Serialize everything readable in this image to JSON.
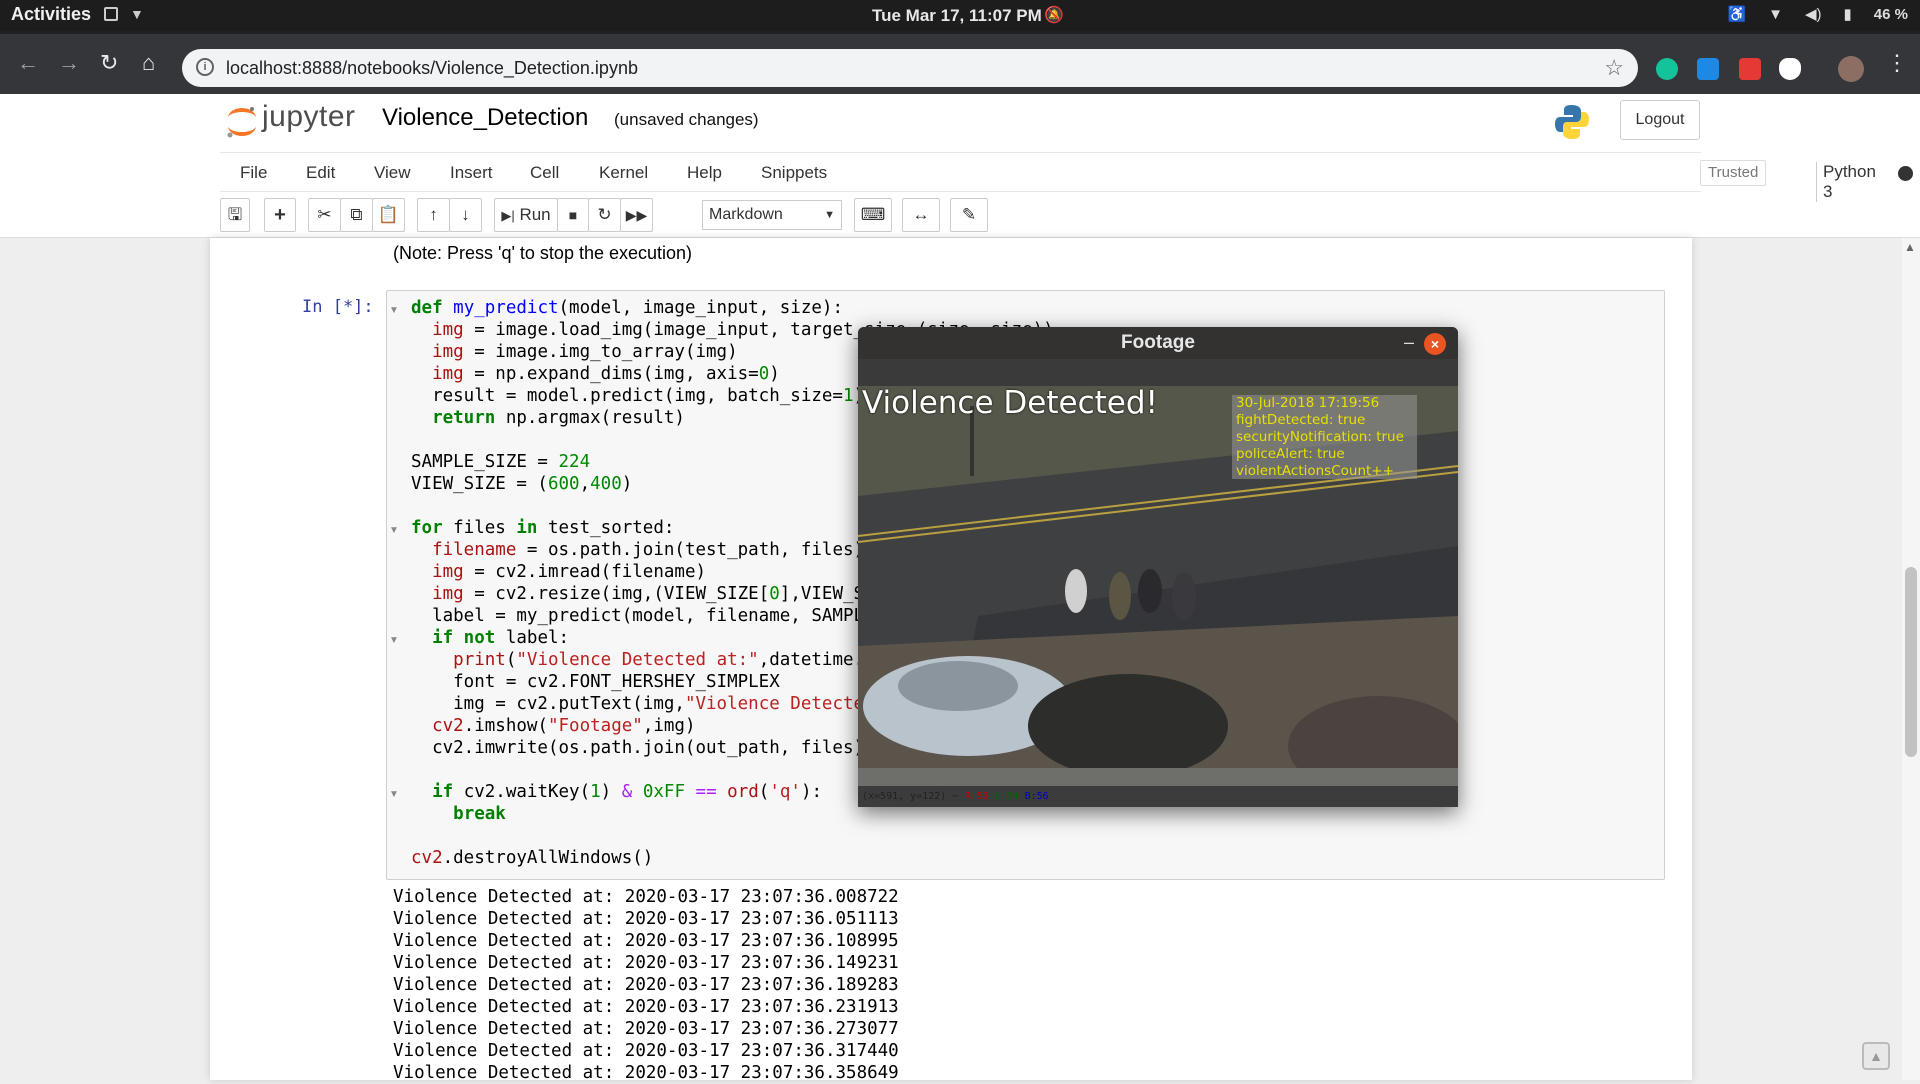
{
  "system": {
    "activities": "Activities",
    "clock": "Tue Mar 17, 11:07 PM",
    "battery": "46 %"
  },
  "browser": {
    "url": "localhost:8888/notebooks/Violence_Detection.ipynb"
  },
  "jupyter": {
    "logo_text": "jupyter",
    "notebook_title": "Violence_Detection",
    "save_status": "(unsaved changes)",
    "logout": "Logout",
    "menus": [
      "File",
      "Edit",
      "View",
      "Insert",
      "Cell",
      "Kernel",
      "Help",
      "Snippets"
    ],
    "trusted": "Trusted",
    "kernel": "Python 3",
    "run_label": "Run",
    "cell_type": "Markdown"
  },
  "notebook": {
    "note": "(Note: Press 'q' to stop the execution)",
    "prompt": "In [*]:",
    "output_lines": [
      "Violence Detected at: 2020-03-17 23:07:36.008722",
      "Violence Detected at: 2020-03-17 23:07:36.051113",
      "Violence Detected at: 2020-03-17 23:07:36.108995",
      "Violence Detected at: 2020-03-17 23:07:36.149231",
      "Violence Detected at: 2020-03-17 23:07:36.189283",
      "Violence Detected at: 2020-03-17 23:07:36.231913",
      "Violence Detected at: 2020-03-17 23:07:36.273077",
      "Violence Detected at: 2020-03-17 23:07:36.317440",
      "Violence Detected at: 2020-03-17 23:07:36.358649"
    ]
  },
  "footage": {
    "title": "Footage",
    "label": "Violence Detected!",
    "overlay": {
      "timestamp": "30-Jul-2018 17:19:56",
      "fight": "fightDetected: true",
      "security": "securityNotification: true",
      "police": "policeAlert: true",
      "count": "violentActionsCount++"
    },
    "status_coords": "(x=591, y=122) ~",
    "status_r": "R:53",
    "status_g": "G:54",
    "status_b": "B:56"
  }
}
